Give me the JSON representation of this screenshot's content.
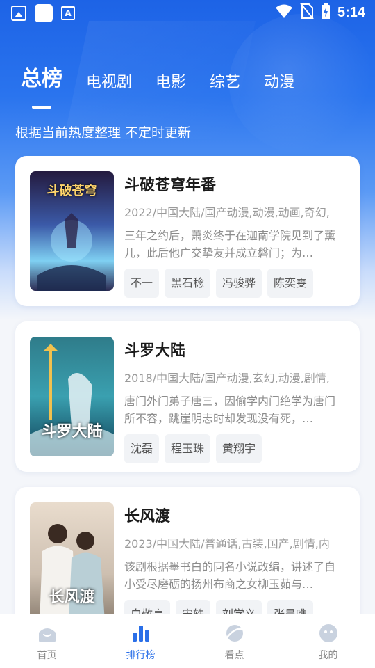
{
  "status_bar": {
    "time": "5:14",
    "left_icons": [
      "image-icon",
      "app-square-icon",
      "a-icon"
    ],
    "right_icons": [
      "wifi-icon",
      "no-sim-icon",
      "battery-charging-icon"
    ]
  },
  "tabs": [
    {
      "label": "总榜",
      "active": true
    },
    {
      "label": "电视剧",
      "active": false
    },
    {
      "label": "电影",
      "active": false
    },
    {
      "label": "综艺",
      "active": false
    },
    {
      "label": "动漫",
      "active": false
    }
  ],
  "subtitle": "根据当前热度整理 不定时更新",
  "cards": [
    {
      "title": "斗破苍穹年番",
      "meta": "2022/中国大陆/国产动漫,动漫,动画,奇幻,",
      "desc": "三年之约后，萧炎终于在迦南学院见到了薰儿，此后他广交挚友并成立磐门；为…",
      "tags": [
        "不一",
        "黑石稔",
        "冯骏骅",
        "陈奕雯"
      ],
      "poster_text": "斗破苍穹"
    },
    {
      "title": "斗罗大陆",
      "meta": "2018/中国大陆/国产动漫,玄幻,动漫,剧情,",
      "desc": "唐门外门弟子唐三，因偷学内门绝学为唐门所不容，跳崖明志时却发现没有死，…",
      "tags": [
        "沈磊",
        "程玉珠",
        "黄翔宇"
      ],
      "poster_text": "斗罗大陆"
    },
    {
      "title": "长风渡",
      "meta": "2023/中国大陆/普通话,古装,国产,剧情,内",
      "desc": "该剧根据墨书白的同名小说改编，讲述了自小受尽磨砺的扬州布商之女柳玉茹与…",
      "tags": [
        "白敬亭",
        "宋轶",
        "刘学义",
        "张昊唯"
      ],
      "poster_text": "长风渡"
    }
  ],
  "bottom_nav": [
    {
      "label": "首页",
      "icon": "home-icon",
      "active": false
    },
    {
      "label": "排行榜",
      "icon": "bar-chart-icon",
      "active": true
    },
    {
      "label": "看点",
      "icon": "planet-icon",
      "active": false
    },
    {
      "label": "我的",
      "icon": "smiley-icon",
      "active": false
    }
  ],
  "colors": {
    "accent": "#2a6fe8",
    "header_blue": "#1d63e6",
    "background": "#f4f6fa"
  }
}
